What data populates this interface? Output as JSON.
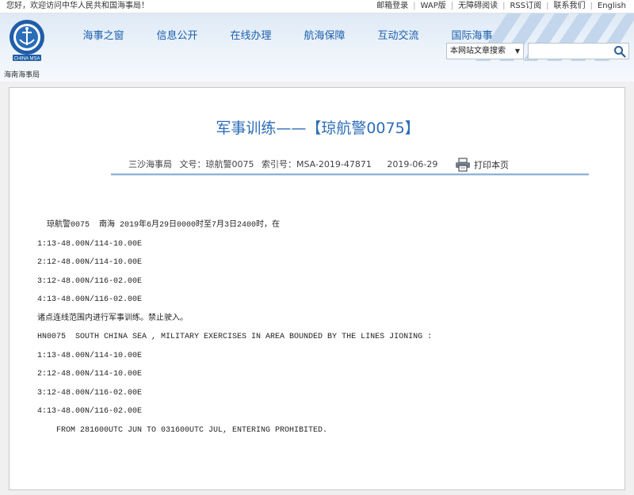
{
  "topbar": {
    "welcome": "您好，欢迎访问中华人民共和国海事局！",
    "links": [
      "邮箱登录",
      "WAP版",
      "无障碍阅读",
      "RSS订阅",
      "联系我们",
      "English"
    ]
  },
  "header": {
    "logo_icon": "china-msa-logo-icon",
    "nav": [
      "海事之窗",
      "信息公开",
      "在线办理",
      "航海保障",
      "互动交流",
      "国际海事"
    ],
    "department": "海南海事局",
    "search": {
      "select_value": "本网站文章搜索",
      "input_value": "",
      "input_placeholder": ""
    }
  },
  "article": {
    "title": "军事训练——【琼航警0075】",
    "meta": {
      "issuer": "三沙海事局",
      "doc_no_label": "文号：",
      "doc_no": "琼航警0075",
      "index_label": "索引号：",
      "index_no": "MSA-2019-47871",
      "date": "2019-06-29",
      "print_label": "打印本页"
    },
    "lines": [
      "  琼航警0075  南海 2019年6月29日0000时至7月3日2400时，在",
      "1:13-48.00N/114-10.00E",
      "2:12-48.00N/114-10.00E",
      "3:12-48.00N/116-02.00E",
      "4:13-48.00N/116-02.00E",
      "诸点连线范围内进行军事训练。禁止驶入。",
      "HN0075  SOUTH CHINA SEA , MILITARY EXERCISES IN AREA BOUNDED BY THE LINES JIONING :",
      "1:13-48.00N/114-10.00E",
      "2:12-48.00N/114-10.00E",
      "3:12-48.00N/116-02.00E",
      "4:13-48.00N/116-02.00E",
      "    FROM 281600UTC JUN TO 031600UTC JUL, ENTERING PROHIBITED."
    ]
  }
}
